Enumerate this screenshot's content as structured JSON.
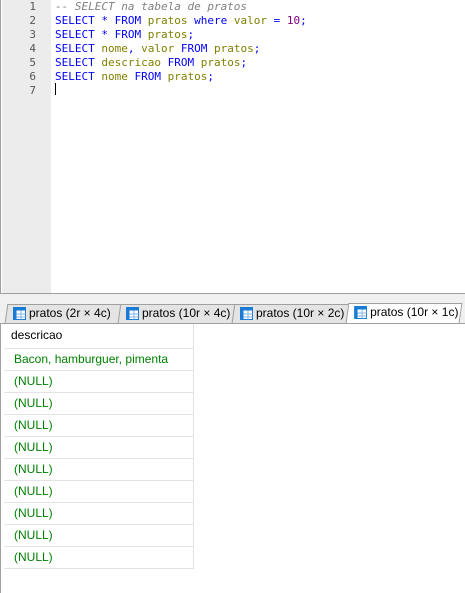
{
  "editor": {
    "line_numbers": [
      "1",
      "2",
      "3",
      "4",
      "5",
      "6",
      "7"
    ],
    "lines": [
      {
        "tokens": [
          {
            "t": "-- SELECT na tabela de pratos",
            "c": "cm"
          }
        ]
      },
      {
        "tokens": [
          {
            "t": "SELECT",
            "c": "kw"
          },
          {
            "t": " ",
            "c": "pl"
          },
          {
            "t": "*",
            "c": "op"
          },
          {
            "t": " ",
            "c": "pl"
          },
          {
            "t": "FROM",
            "c": "kw"
          },
          {
            "t": " ",
            "c": "pl"
          },
          {
            "t": "pratos",
            "c": "id"
          },
          {
            "t": " ",
            "c": "pl"
          },
          {
            "t": "where",
            "c": "kw"
          },
          {
            "t": " ",
            "c": "pl"
          },
          {
            "t": "valor",
            "c": "id"
          },
          {
            "t": " ",
            "c": "pl"
          },
          {
            "t": "=",
            "c": "op"
          },
          {
            "t": " ",
            "c": "pl"
          },
          {
            "t": "10",
            "c": "num"
          },
          {
            "t": ";",
            "c": "op"
          }
        ]
      },
      {
        "tokens": [
          {
            "t": "SELECT",
            "c": "kw"
          },
          {
            "t": " ",
            "c": "pl"
          },
          {
            "t": "*",
            "c": "op"
          },
          {
            "t": " ",
            "c": "pl"
          },
          {
            "t": "FROM",
            "c": "kw"
          },
          {
            "t": " ",
            "c": "pl"
          },
          {
            "t": "pratos",
            "c": "id"
          },
          {
            "t": ";",
            "c": "op"
          }
        ]
      },
      {
        "tokens": [
          {
            "t": "SELECT",
            "c": "kw"
          },
          {
            "t": " ",
            "c": "pl"
          },
          {
            "t": "nome",
            "c": "id"
          },
          {
            "t": ", ",
            "c": "op"
          },
          {
            "t": "valor",
            "c": "id"
          },
          {
            "t": " ",
            "c": "pl"
          },
          {
            "t": "FROM",
            "c": "kw"
          },
          {
            "t": " ",
            "c": "pl"
          },
          {
            "t": "pratos",
            "c": "id"
          },
          {
            "t": ";",
            "c": "op"
          }
        ]
      },
      {
        "tokens": [
          {
            "t": "SELECT",
            "c": "kw"
          },
          {
            "t": " ",
            "c": "pl"
          },
          {
            "t": "descricao",
            "c": "id"
          },
          {
            "t": " ",
            "c": "pl"
          },
          {
            "t": "FROM",
            "c": "kw"
          },
          {
            "t": " ",
            "c": "pl"
          },
          {
            "t": "pratos",
            "c": "id"
          },
          {
            "t": ";",
            "c": "op"
          }
        ]
      },
      {
        "tokens": [
          {
            "t": "SELECT",
            "c": "kw"
          },
          {
            "t": " ",
            "c": "pl"
          },
          {
            "t": "nome",
            "c": "id"
          },
          {
            "t": " ",
            "c": "pl"
          },
          {
            "t": "FROM",
            "c": "kw"
          },
          {
            "t": " ",
            "c": "pl"
          },
          {
            "t": "pratos",
            "c": "id"
          },
          {
            "t": ";",
            "c": "op"
          }
        ]
      },
      {
        "tokens": []
      }
    ]
  },
  "tabs": [
    {
      "label": "pratos (2r × 4c)",
      "active": false,
      "icon": "table-grid-icon"
    },
    {
      "label": "pratos (10r × 4c)",
      "active": false,
      "icon": "table-grid-icon"
    },
    {
      "label": "pratos (10r × 2c)",
      "active": false,
      "icon": "table-grid-icon"
    },
    {
      "label": "pratos (10r × 1c)",
      "active": true,
      "icon": "table-grid-icon"
    }
  ],
  "results": {
    "column": "descricao",
    "rows": [
      "Bacon, hamburguer, pimenta",
      "(NULL)",
      "(NULL)",
      "(NULL)",
      "(NULL)",
      "(NULL)",
      "(NULL)",
      "(NULL)",
      "(NULL)",
      "(NULL)"
    ]
  },
  "colors": {
    "keyword": "#0000ff",
    "identifier": "#808000",
    "number": "#800080",
    "comment": "#808080",
    "cell_text": "#008000",
    "gutter": "#ececec"
  }
}
